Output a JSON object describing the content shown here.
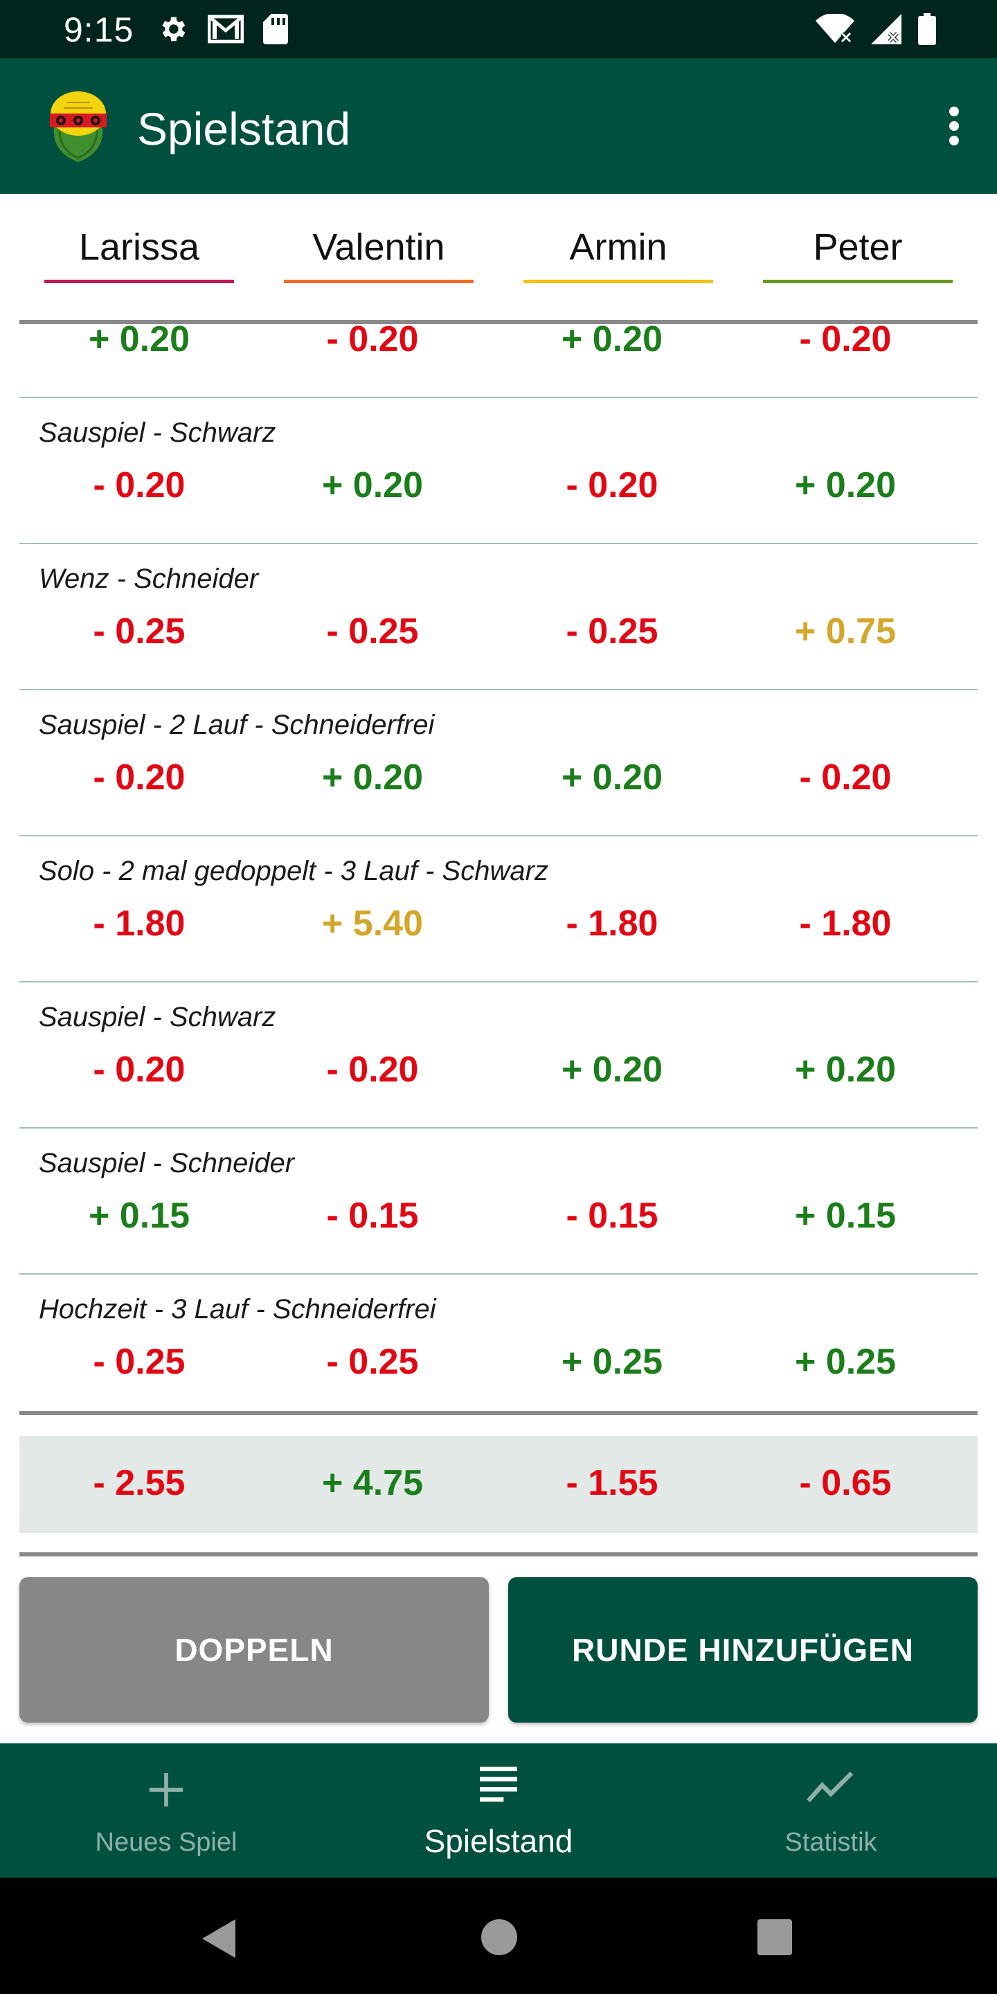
{
  "status_bar": {
    "time": "9:15",
    "left_icons": [
      "settings-icon",
      "gmail-icon",
      "sd-card-icon"
    ],
    "right_icons": [
      "wifi-icon",
      "signal-icon",
      "battery-icon"
    ]
  },
  "app_bar": {
    "title": "Spielstand",
    "logo": "app-logo",
    "menu_icon": "overflow-menu-icon"
  },
  "players": [
    {
      "name": "Larissa",
      "color": "#c2185b"
    },
    {
      "name": "Valentin",
      "color": "#f26b21"
    },
    {
      "name": "Armin",
      "color": "#f2c20f"
    },
    {
      "name": "Peter",
      "color": "#6a9a1f"
    }
  ],
  "colors": {
    "positive": "#1b7e1b",
    "negative": "#e30613",
    "highlight": "#d4a62a",
    "primary": "#00503f",
    "status_bar": "#00251c"
  },
  "rounds": [
    {
      "label": "",
      "values": [
        {
          "text": "+ 0.20",
          "color": "#1b7e1b"
        },
        {
          "text": "- 0.20",
          "color": "#e30613"
        },
        {
          "text": "+ 0.20",
          "color": "#1b7e1b"
        },
        {
          "text": "- 0.20",
          "color": "#e30613"
        }
      ]
    },
    {
      "label": "Sauspiel - Schwarz",
      "values": [
        {
          "text": "- 0.20",
          "color": "#e30613"
        },
        {
          "text": "+ 0.20",
          "color": "#1b7e1b"
        },
        {
          "text": "- 0.20",
          "color": "#e30613"
        },
        {
          "text": "+ 0.20",
          "color": "#1b7e1b"
        }
      ]
    },
    {
      "label": "Wenz - Schneider",
      "values": [
        {
          "text": "- 0.25",
          "color": "#e30613"
        },
        {
          "text": "- 0.25",
          "color": "#e30613"
        },
        {
          "text": "- 0.25",
          "color": "#e30613"
        },
        {
          "text": "+ 0.75",
          "color": "#d4a62a"
        }
      ]
    },
    {
      "label": "Sauspiel - 2 Lauf - Schneiderfrei",
      "values": [
        {
          "text": "- 0.20",
          "color": "#e30613"
        },
        {
          "text": "+ 0.20",
          "color": "#1b7e1b"
        },
        {
          "text": "+ 0.20",
          "color": "#1b7e1b"
        },
        {
          "text": "- 0.20",
          "color": "#e30613"
        }
      ]
    },
    {
      "label": "Solo - 2 mal gedoppelt - 3 Lauf - Schwarz",
      "values": [
        {
          "text": "- 1.80",
          "color": "#e30613"
        },
        {
          "text": "+ 5.40",
          "color": "#d4a62a"
        },
        {
          "text": "- 1.80",
          "color": "#e30613"
        },
        {
          "text": "- 1.80",
          "color": "#e30613"
        }
      ]
    },
    {
      "label": "Sauspiel - Schwarz",
      "values": [
        {
          "text": "- 0.20",
          "color": "#e30613"
        },
        {
          "text": "- 0.20",
          "color": "#e30613"
        },
        {
          "text": "+ 0.20",
          "color": "#1b7e1b"
        },
        {
          "text": "+ 0.20",
          "color": "#1b7e1b"
        }
      ]
    },
    {
      "label": "Sauspiel - Schneider",
      "values": [
        {
          "text": "+ 0.15",
          "color": "#1b7e1b"
        },
        {
          "text": "- 0.15",
          "color": "#e30613"
        },
        {
          "text": "- 0.15",
          "color": "#e30613"
        },
        {
          "text": "+ 0.15",
          "color": "#1b7e1b"
        }
      ]
    },
    {
      "label": "Hochzeit - 3 Lauf - Schneiderfrei",
      "values": [
        {
          "text": "- 0.25",
          "color": "#e30613"
        },
        {
          "text": "- 0.25",
          "color": "#e30613"
        },
        {
          "text": "+ 0.25",
          "color": "#1b7e1b"
        },
        {
          "text": "+ 0.25",
          "color": "#1b7e1b"
        }
      ]
    }
  ],
  "totals": [
    {
      "text": "- 2.55",
      "color": "#e30613"
    },
    {
      "text": "+ 4.75",
      "color": "#1b7e1b"
    },
    {
      "text": "- 1.55",
      "color": "#e30613"
    },
    {
      "text": "- 0.65",
      "color": "#e30613"
    }
  ],
  "buttons": {
    "double": "DOPPELN",
    "add_round": "RUNDE HINZUFÜGEN"
  },
  "bottom_nav": [
    {
      "label": "Neues Spiel",
      "icon": "plus-icon",
      "active": false
    },
    {
      "label": "Spielstand",
      "icon": "list-icon",
      "active": true
    },
    {
      "label": "Statistik",
      "icon": "chart-line-icon",
      "active": false
    }
  ],
  "system_nav": [
    "back-icon",
    "home-icon",
    "recents-icon"
  ]
}
